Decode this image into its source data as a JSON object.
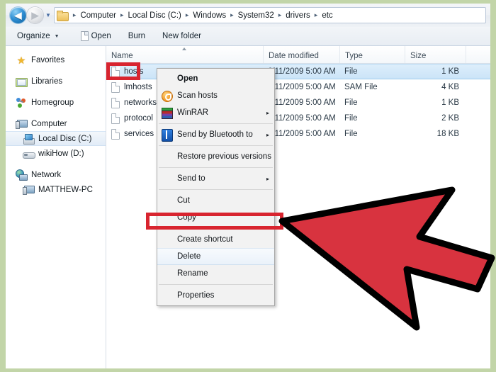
{
  "theme": {
    "page_border_color": "#c2d5a8",
    "highlight_color": "#d8242f",
    "cursor_color": "#d8333f",
    "selection_color": "#cbe4f8"
  },
  "addressbar": {
    "back_icon": "back-arrow-icon",
    "back_glyph": "◀",
    "forward_icon": "forward-arrow-icon",
    "forward_glyph": "▶",
    "history_caret": "▼",
    "folder_icon": "folder-icon",
    "separator": "▸",
    "crumbs": [
      "Computer",
      "Local Disc (C:)",
      "Windows",
      "System32",
      "drivers",
      "etc"
    ]
  },
  "toolbar": {
    "organize_label": "Organize",
    "organize_caret": "▼",
    "open_label": "Open",
    "open_icon": "document-icon",
    "burn_label": "Burn",
    "new_folder_label": "New folder"
  },
  "sidebar": {
    "items": [
      {
        "label": "Favorites",
        "icon": "star-icon",
        "level": 0,
        "selected": false
      },
      {
        "label": "Libraries",
        "icon": "libraries-icon",
        "level": 0,
        "selected": false
      },
      {
        "label": "Homegroup",
        "icon": "homegroup-icon",
        "level": 0,
        "selected": false
      },
      {
        "label": "Computer",
        "icon": "computer-icon",
        "level": 0,
        "selected": false
      },
      {
        "label": "Local Disc (C:)",
        "icon": "hard-disc-icon",
        "level": 1,
        "selected": true
      },
      {
        "label": "wikiHow (D:)",
        "icon": "removable-drive-icon",
        "level": 1,
        "selected": false
      },
      {
        "label": "Network",
        "icon": "network-icon",
        "level": 0,
        "selected": false
      },
      {
        "label": "MATTHEW-PC",
        "icon": "computer-icon",
        "level": 1,
        "selected": false
      }
    ]
  },
  "filelist": {
    "columns": [
      "Name",
      "Date modified",
      "Type",
      "Size"
    ],
    "sorted_column": "Name",
    "rows": [
      {
        "name": "hosts",
        "date": "6/11/2009 5:00 AM",
        "type": "File",
        "size": "1 KB",
        "selected": true
      },
      {
        "name": "lmhosts",
        "date": "6/11/2009 5:00 AM",
        "type": "SAM File",
        "size": "4 KB",
        "selected": false
      },
      {
        "name": "networks",
        "date": "6/11/2009 5:00 AM",
        "type": "File",
        "size": "1 KB",
        "selected": false
      },
      {
        "name": "protocol",
        "date": "6/11/2009 5:00 AM",
        "type": "File",
        "size": "2 KB",
        "selected": false
      },
      {
        "name": "services",
        "date": "6/11/2009 5:00 AM",
        "type": "File",
        "size": "18 KB",
        "selected": false
      }
    ]
  },
  "context_menu": {
    "items": [
      {
        "label": "Open",
        "icon": null,
        "bold": true,
        "submenu": false,
        "highlighted": false,
        "sep_after": false
      },
      {
        "label": "Scan hosts",
        "icon": "scan-icon",
        "bold": false,
        "submenu": false,
        "highlighted": false,
        "sep_after": false
      },
      {
        "label": "WinRAR",
        "icon": "winrar-icon",
        "bold": false,
        "submenu": true,
        "highlighted": false,
        "sep_after": true
      },
      {
        "label": "Send by Bluetooth to",
        "icon": "bluetooth-icon",
        "bold": false,
        "submenu": true,
        "highlighted": false,
        "sep_after": true
      },
      {
        "label": "Restore previous versions",
        "icon": null,
        "bold": false,
        "submenu": false,
        "highlighted": false,
        "sep_after": true
      },
      {
        "label": "Send to",
        "icon": null,
        "bold": false,
        "submenu": true,
        "highlighted": false,
        "sep_after": true
      },
      {
        "label": "Cut",
        "icon": null,
        "bold": false,
        "submenu": false,
        "highlighted": false,
        "sep_after": false
      },
      {
        "label": "Copy",
        "icon": null,
        "bold": false,
        "submenu": false,
        "highlighted": false,
        "sep_after": true
      },
      {
        "label": "Create shortcut",
        "icon": null,
        "bold": false,
        "submenu": false,
        "highlighted": false,
        "sep_after": false
      },
      {
        "label": "Delete",
        "icon": null,
        "bold": false,
        "submenu": false,
        "highlighted": true,
        "sep_after": false
      },
      {
        "label": "Rename",
        "icon": null,
        "bold": false,
        "submenu": false,
        "highlighted": false,
        "sep_after": true
      },
      {
        "label": "Properties",
        "icon": null,
        "bold": false,
        "submenu": false,
        "highlighted": false,
        "sep_after": false
      }
    ],
    "submenu_caret": "▸"
  },
  "annotations": {
    "hosts_highlight": "red-box-around-hosts-file",
    "delete_highlight": "red-box-around-delete-menu-item",
    "cursor": "large-red-mouse-pointer"
  }
}
